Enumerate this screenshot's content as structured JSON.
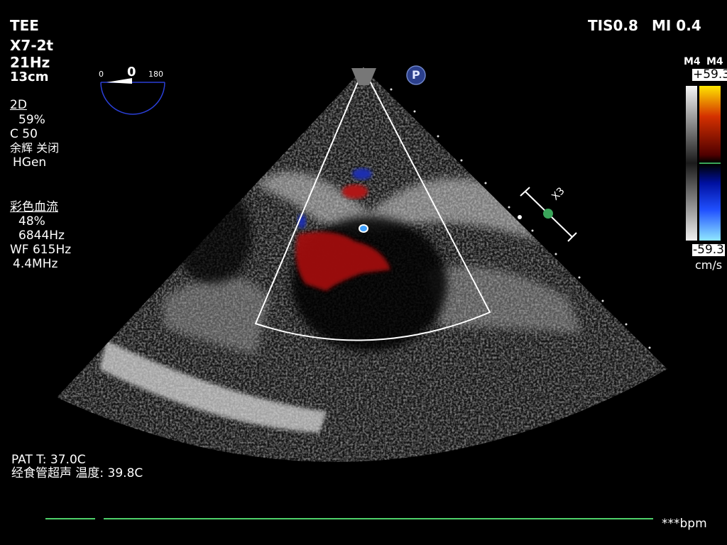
{
  "probe": {
    "mode": "TEE",
    "transducer": "X7-2t",
    "frame_rate": "21Hz",
    "depth": "13cm"
  },
  "safety": {
    "tis": "TIS0.8",
    "mi": "MI 0.4"
  },
  "angle_indicator": {
    "min": "0",
    "current": "0",
    "max": "180",
    "probe_marker": "P",
    "focus_label": "X3"
  },
  "imaging_2d": {
    "title": "2D",
    "gain": "59%",
    "compress": "C 50",
    "persistence": "余辉 关闭",
    "frequency": "HGen"
  },
  "color_flow": {
    "title": "彩色血流",
    "gain": "48%",
    "prf": "6844Hz",
    "wall_filter": "WF 615Hz",
    "frequency": "4.4MHz"
  },
  "color_scale": {
    "map_left": "M4",
    "map_right": "M4",
    "max": "+59.3",
    "min": "-59.3",
    "unit": "cm/s"
  },
  "temperature": {
    "patient": "PAT T: 37.0C",
    "probe": "经食管超声 温度: 39.8C"
  },
  "ecg": {
    "heart_rate": "***bpm"
  },
  "colors": {
    "ecg_trace": "#4ed06a",
    "sector_outline": "#ffffff",
    "angle_arc": "#2a3fd6",
    "focus_marker": "#3aa55a"
  }
}
